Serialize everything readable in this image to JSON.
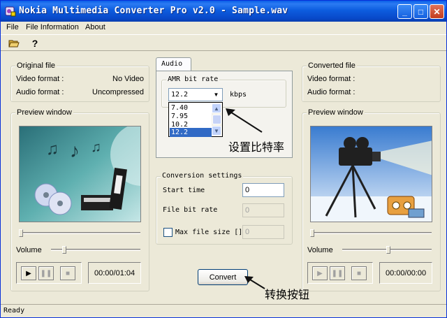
{
  "window": {
    "title": "Nokia Multimedia Converter Pro v2.0 - Sample.wav"
  },
  "menu": [
    "File",
    "File Information",
    "About"
  ],
  "original": {
    "legend": "Original file",
    "video_label": "Video format :",
    "video_value": "No Video",
    "audio_label": "Audio format :",
    "audio_value": "Uncompressed"
  },
  "preview_left": {
    "legend": "Preview window",
    "volume_label": "Volume",
    "time": "00:00/01:04"
  },
  "audio_tab": {
    "tab_label": "Audio",
    "group_legend": "AMR bit rate",
    "selected": "12.2",
    "unit": "kbps",
    "options": [
      "7.40",
      "7.95",
      "10.2",
      "12.2"
    ]
  },
  "conversion": {
    "legend": "Conversion settings",
    "start_label": "Start time",
    "start_value": "0",
    "bitrate_label": "File bit rate",
    "bitrate_value": "0",
    "maxsize_label": "Max file size []",
    "maxsize_value": "0"
  },
  "convert_label": "Convert",
  "converted": {
    "legend": "Converted file",
    "video_label": "Video format :",
    "audio_label": "Audio format :"
  },
  "preview_right": {
    "legend": "Preview window",
    "volume_label": "Volume",
    "time": "00:00/00:00"
  },
  "annotations": {
    "bitrate_note": "设置比特率",
    "convert_note": "转换按钮"
  },
  "status": "Ready",
  "colors": {
    "titlebar": "#0a5ee8",
    "window_bg": "#ece9d8",
    "selection": "#316ac5"
  },
  "icons": [
    "app-icon",
    "minimize-icon",
    "maximize-icon",
    "close-icon",
    "open-folder-icon",
    "help-icon",
    "play-icon",
    "pause-icon",
    "stop-icon",
    "dropdown-arrow-icon",
    "scroll-up-icon",
    "scroll-down-icon",
    "arrow-annotation-icon"
  ]
}
